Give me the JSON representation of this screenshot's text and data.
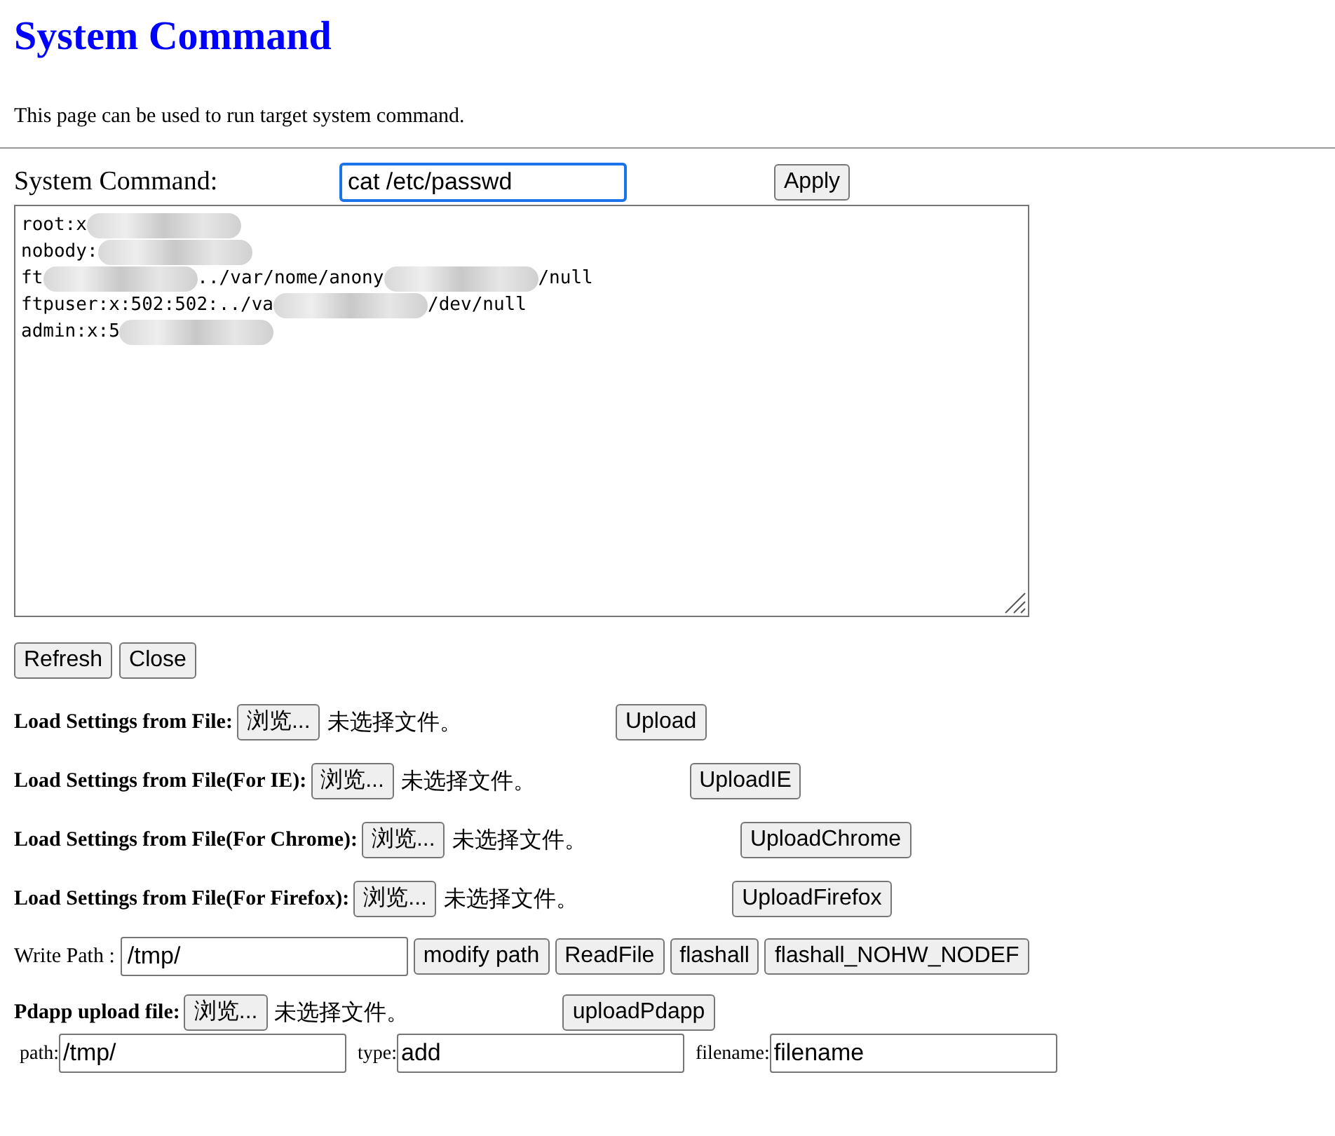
{
  "title": "System Command",
  "description": "This page can be used to run target system command.",
  "command": {
    "label": "System Command:",
    "value": "cat /etc/passwd",
    "button": "Apply"
  },
  "output": {
    "lines": [
      [
        {
          "kind": "text",
          "text": "root:x"
        },
        {
          "kind": "redacted"
        }
      ],
      [
        {
          "kind": "text",
          "text": "nobody:"
        },
        {
          "kind": "redacted"
        }
      ],
      [
        {
          "kind": "text",
          "text": "ft"
        },
        {
          "kind": "redacted"
        },
        {
          "kind": "text",
          "text": "../var/nome/anony"
        },
        {
          "kind": "redacted"
        },
        {
          "kind": "text",
          "text": "/null"
        }
      ],
      [
        {
          "kind": "text",
          "text": "ftpuser:x:502:502:../va"
        },
        {
          "kind": "redacted"
        },
        {
          "kind": "text",
          "text": "/dev/null"
        }
      ],
      [
        {
          "kind": "text",
          "text": "admin:x:5"
        },
        {
          "kind": "redacted"
        }
      ]
    ]
  },
  "buttons": [
    "Refresh",
    "Close"
  ],
  "uploads": [
    {
      "label": "Load Settings from File:",
      "browse": "浏览...",
      "status": "未选择文件。",
      "button": "Upload"
    },
    {
      "label": "Load Settings from File(For IE):",
      "browse": "浏览...",
      "status": "未选择文件。",
      "button": "UploadIE"
    },
    {
      "label": "Load Settings from File(For Chrome):",
      "browse": "浏览...",
      "status": "未选择文件。",
      "button": "UploadChrome"
    },
    {
      "label": "Load Settings from File(For Firefox):",
      "browse": "浏览...",
      "status": "未选择文件。",
      "button": "UploadFirefox"
    }
  ],
  "write_path": {
    "label": "Write Path :",
    "value": "/tmp/",
    "buttons": [
      "modify path",
      "ReadFile",
      "flashall",
      "flashall_NOHW_NODEF"
    ]
  },
  "pdapp": {
    "label": "Pdapp upload file:",
    "browse": "浏览...",
    "status": "未选择文件。",
    "button": "uploadPdapp",
    "fields": [
      {
        "label": "path:",
        "value": "/tmp/"
      },
      {
        "label": "type:",
        "value": "add"
      },
      {
        "label": "filename:",
        "value": "filename"
      }
    ]
  }
}
